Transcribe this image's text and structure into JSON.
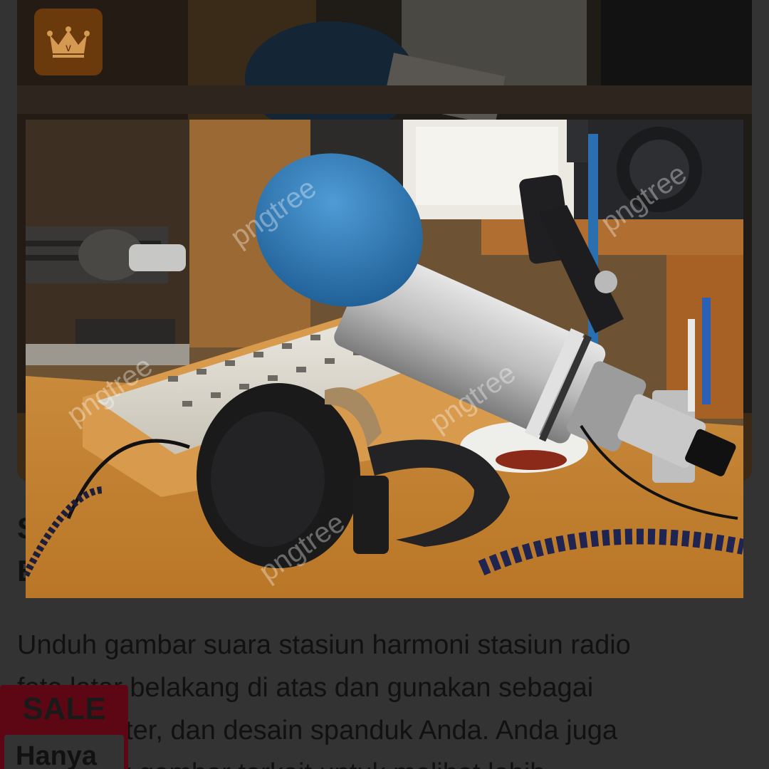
{
  "premium_badge": {
    "icon": "crown-icon",
    "letter": "V",
    "color": "#e0a45a"
  },
  "background_title": {
    "line1": "S",
    "line2": "E"
  },
  "description": {
    "line1": "Unduh gambar suara stasiun harmoni stasiun radio",
    "line2": "foto latar belakang di atas dan gunakan sebagai",
    "line3": "flyer, poster, dan desain spanduk Anda. Anda juga",
    "line4": "dapat klik gambar terkait untuk melihat lebih"
  },
  "sale_badge": {
    "label": "SALE",
    "sub_label": "Hanya",
    "color": "#5e0714"
  },
  "preview": {
    "watermark": "pngtree",
    "subject": "radio studio microphone headphones mixer"
  }
}
